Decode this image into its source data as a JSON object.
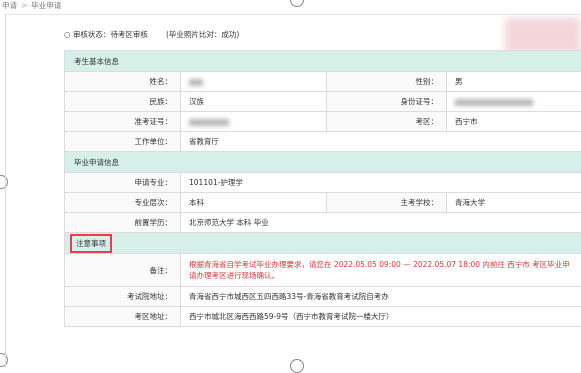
{
  "breadcrumb": {
    "parent": "申请",
    "sep": ">",
    "current": "毕业申请"
  },
  "status": {
    "label": "审核状态：",
    "value": "待考区审核",
    "photo_label": "(毕业照片比对：成功)"
  },
  "sections": {
    "basic": "考生基本信息",
    "apply": "毕业申请信息",
    "notice": "注意事项"
  },
  "basic": {
    "name_label": "姓名：",
    "gender_label": "性别：",
    "gender": "男",
    "ethnic_label": "民族：",
    "ethnic": "汉族",
    "id_label": "身份证号：",
    "ticket_label": "准考证号：",
    "area_label": "考区：",
    "area": "西宁市",
    "work_label": "工作单位：",
    "work": "省教育厅"
  },
  "apply": {
    "major_label": "申请专业：",
    "major": "101101-护理学",
    "level_label": "专业层次：",
    "level": "本科",
    "school_label": "主考学校：",
    "school": "青海大学",
    "prev_label": "前置学历：",
    "prev": "北京师范大学 本科 毕业"
  },
  "notice": {
    "remark_label": "备注：",
    "remark": "根据青海省自学考试毕业办理要求，请您在 2022.05.05 09:00 — 2022.05.07 18:00 内前往 西宁市 考区毕业申请办理考区进行现场确认。",
    "exam_addr_label": "考试院地址：",
    "exam_addr": "青海省西宁市城西区五四西路33号-青海省教育考试院自考办",
    "area_addr_label": "考区地址：",
    "area_addr": "西宁市城北区海西西路59-9号（西宁市教育考试院一楼大厅）"
  }
}
